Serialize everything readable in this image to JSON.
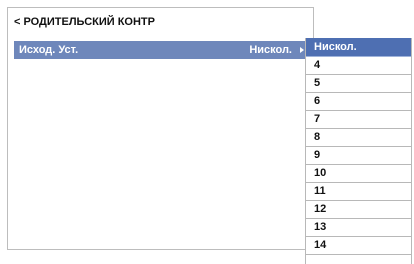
{
  "header": {
    "back_glyph": "<",
    "title": "РОДИТЕЛЬСКИЙ КОНТР"
  },
  "setting": {
    "label": "Исход. Уст.",
    "value": "Нискол.",
    "arrow_icon": "arrow-right-icon"
  },
  "dropdown": {
    "selected_index": 0,
    "options": [
      "Нискол.",
      "4",
      "5",
      "6",
      "7",
      "8",
      "9",
      "10",
      "11",
      "12",
      "13",
      "14"
    ]
  },
  "colors": {
    "row_highlight": "#6e87bb",
    "dropdown_selected": "#4e6fb2",
    "border": "#b8b8b8"
  }
}
